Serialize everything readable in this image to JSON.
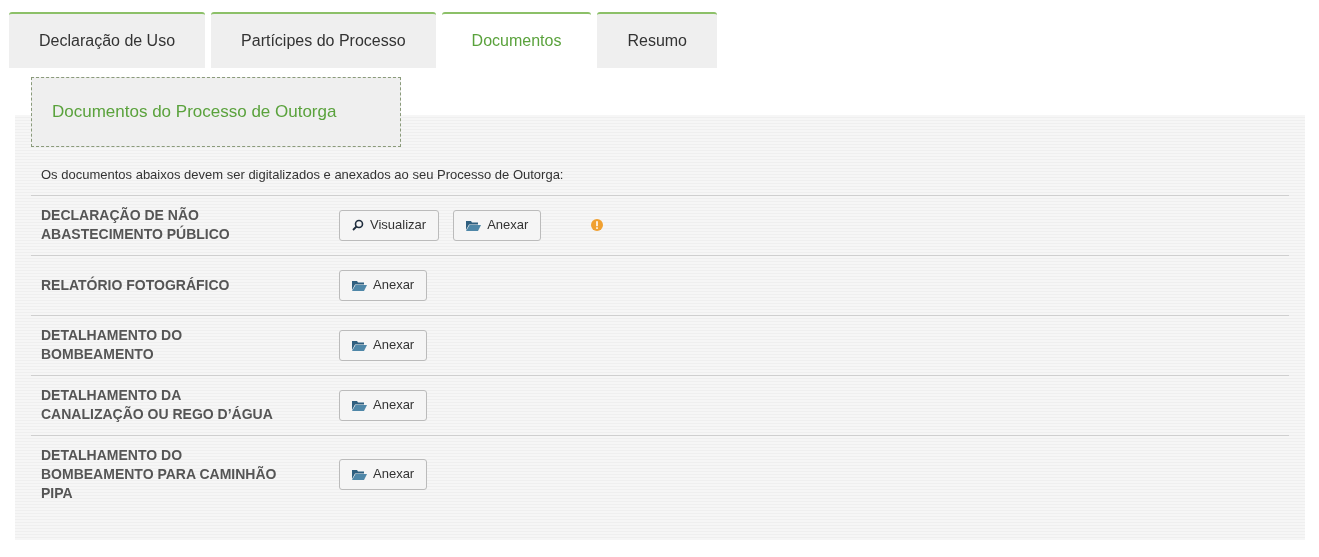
{
  "tabs": [
    {
      "label": "Declaração de Uso",
      "selected": false
    },
    {
      "label": "Partícipes do Processo",
      "selected": false
    },
    {
      "label": "Documentos",
      "selected": true
    },
    {
      "label": "Resumo",
      "selected": false
    }
  ],
  "section_title": "Documentos do Processo de Outorga",
  "intro": "Os documentos abaixos devem ser digitalizados e anexados ao seu Processo de Outorga:",
  "documents": [
    {
      "name": "DECLARAÇÃO DE NÃO ABASTECIMENTO PÚBLICO",
      "buttons": [
        {
          "kind": "view",
          "label": "Visualizar"
        },
        {
          "kind": "attach",
          "label": "Anexar"
        }
      ],
      "warning": true
    },
    {
      "name": "RELATÓRIO FOTOGRÁFICO",
      "buttons": [
        {
          "kind": "attach",
          "label": "Anexar"
        }
      ],
      "warning": false
    },
    {
      "name": "DETALHAMENTO DO BOMBEAMENTO",
      "buttons": [
        {
          "kind": "attach",
          "label": "Anexar"
        }
      ],
      "warning": false
    },
    {
      "name": "DETALHAMENTO DA CANALIZAÇÃO OU REGO D’ÁGUA",
      "buttons": [
        {
          "kind": "attach",
          "label": "Anexar"
        }
      ],
      "warning": false
    },
    {
      "name": "DETALHAMENTO DO BOMBEAMENTO PARA CAMINHÃO PIPA",
      "buttons": [
        {
          "kind": "attach",
          "label": "Anexar"
        }
      ],
      "warning": false
    }
  ]
}
